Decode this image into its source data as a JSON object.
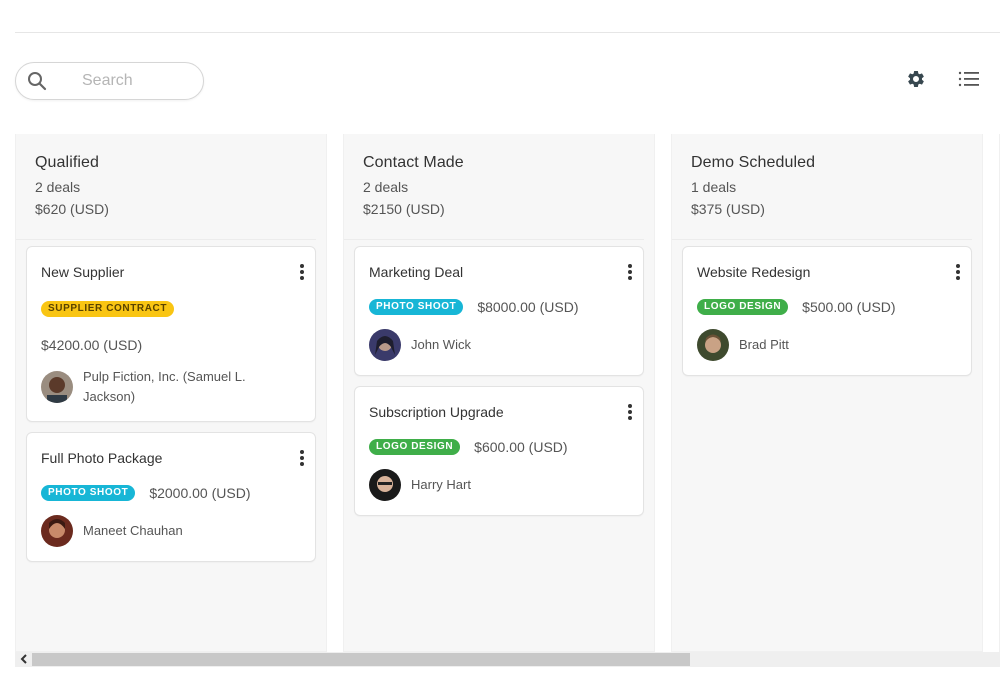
{
  "search": {
    "placeholder": "Search",
    "value": ""
  },
  "toolbar": {
    "settings_icon": "gear-icon",
    "view_icon": "list-icon"
  },
  "colors": {
    "supplier_contract": "#f9c513",
    "photo_shoot": "#17b6d6",
    "logo_design": "#3fae49",
    "column_bg": "#f7f7f7"
  },
  "columns": [
    {
      "title": "Qualified",
      "count": "2 deals",
      "total": "$620 (USD)",
      "cards": [
        {
          "title": "New Supplier",
          "tag": "SUPPLIER CONTRACT",
          "tag_color": "yellow",
          "price": "$4200.00 (USD)",
          "person": "Pulp Fiction, Inc. (Samuel L. Jackson)"
        },
        {
          "title": "Full Photo Package",
          "tag": "PHOTO SHOOT",
          "tag_color": "cyan",
          "price": "$2000.00 (USD)",
          "person": "Maneet Chauhan"
        }
      ]
    },
    {
      "title": "Contact Made",
      "count": "2 deals",
      "total": "$2150 (USD)",
      "cards": [
        {
          "title": "Marketing Deal",
          "tag": "PHOTO SHOOT",
          "tag_color": "cyan",
          "price": "$8000.00 (USD)",
          "person": "John Wick"
        },
        {
          "title": "Subscription Upgrade",
          "tag": "LOGO DESIGN",
          "tag_color": "green",
          "price": "$600.00 (USD)",
          "person": "Harry Hart"
        }
      ]
    },
    {
      "title": "Demo Scheduled",
      "count": "1 deals",
      "total": "$375 (USD)",
      "cards": [
        {
          "title": "Website Redesign",
          "tag": "LOGO DESIGN",
          "tag_color": "green",
          "price": "$500.00 (USD)",
          "person": "Brad Pitt"
        }
      ]
    }
  ],
  "scrollbar": {
    "position_fraction": 0.0,
    "visible_fraction": 0.68
  }
}
